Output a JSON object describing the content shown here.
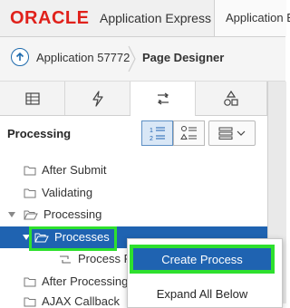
{
  "header": {
    "brand": "ORACLE",
    "product": "Application Express",
    "app_button": "Application E"
  },
  "breadcrumb": {
    "app": "Application 57772",
    "page": "Page Designer"
  },
  "tabs": [
    {
      "icon": "table-icon"
    },
    {
      "icon": "lightning-icon"
    },
    {
      "icon": "processing-icon",
      "active": true
    },
    {
      "icon": "shapes-icon"
    }
  ],
  "panel": {
    "title": "Processing"
  },
  "tree": [
    {
      "label": "After Submit"
    },
    {
      "label": "Validating"
    },
    {
      "label": "Processing",
      "expanded": true
    },
    {
      "label": "Processes",
      "selected": true
    },
    {
      "label": "Process Re"
    },
    {
      "label": "After Processing"
    },
    {
      "label": "AJAX Callback"
    }
  ],
  "context_menu": {
    "items": [
      "Create Process",
      "Expand All Below"
    ]
  },
  "colors": {
    "oracle_red": "#e0211b",
    "selection_blue": "#1f63b1",
    "highlight_green": "#2ee02e"
  }
}
